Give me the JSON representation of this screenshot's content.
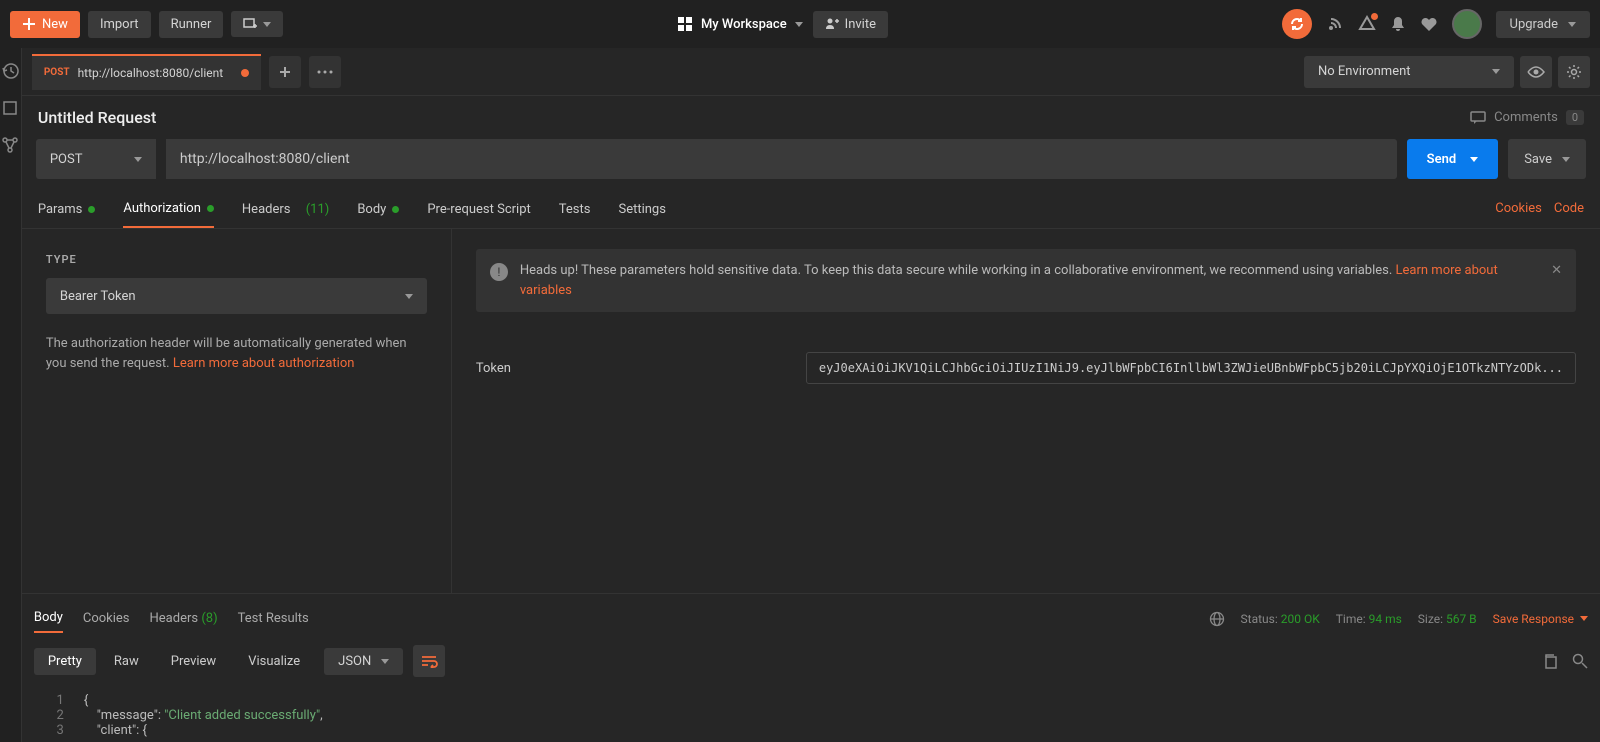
{
  "topbar": {
    "new_label": "New",
    "import_label": "Import",
    "runner_label": "Runner",
    "workspace_label": "My Workspace",
    "invite_label": "Invite",
    "upgrade_label": "Upgrade"
  },
  "env": {
    "selected": "No Environment"
  },
  "tab": {
    "method": "POST",
    "url": "http://localhost:8080/client"
  },
  "request": {
    "title": "Untitled Request",
    "comments_label": "Comments",
    "comments_count": "0",
    "method": "POST",
    "url": "http://localhost:8080/client",
    "send_label": "Send",
    "save_label": "Save"
  },
  "subtabs": {
    "params": "Params",
    "authorization": "Authorization",
    "headers": "Headers",
    "headers_count": "(11)",
    "body": "Body",
    "prerequest": "Pre-request Script",
    "tests": "Tests",
    "settings": "Settings",
    "cookies_link": "Cookies",
    "code_link": "Code"
  },
  "auth": {
    "type_label": "TYPE",
    "type_selected": "Bearer Token",
    "help_text": "The authorization header will be automatically generated when you send the request. ",
    "help_link": "Learn more about authorization",
    "warn_text": "Heads up! These parameters hold sensitive data. To keep this data secure while working in a collaborative environment, we recommend using variables. ",
    "warn_link": "Learn more about variables",
    "token_label": "Token",
    "token_value": "eyJ0eXAiOiJKV1QiLCJhbGciOiJIUzI1NiJ9.eyJlbWFpbCI6InllbWl3ZWJieUBnbWFpbC5jb20iLCJpYXQiOjE1OTkzNTYzODk..."
  },
  "response": {
    "tabs": {
      "body": "Body",
      "cookies": "Cookies",
      "headers": "Headers",
      "headers_count": "(8)",
      "test_results": "Test Results"
    },
    "status_label": "Status:",
    "status_value": "200 OK",
    "time_label": "Time:",
    "time_value": "94 ms",
    "size_label": "Size:",
    "size_value": "567 B",
    "save_response": "Save Response",
    "view": {
      "pretty": "Pretty",
      "raw": "Raw",
      "preview": "Preview",
      "visualize": "Visualize",
      "format": "JSON"
    },
    "body_lines": {
      "l1": "{",
      "l2_key": "\"message\"",
      "l2_val": "\"Client added successfully\"",
      "l3_key": "\"client\"",
      "l3_val": "{"
    }
  }
}
